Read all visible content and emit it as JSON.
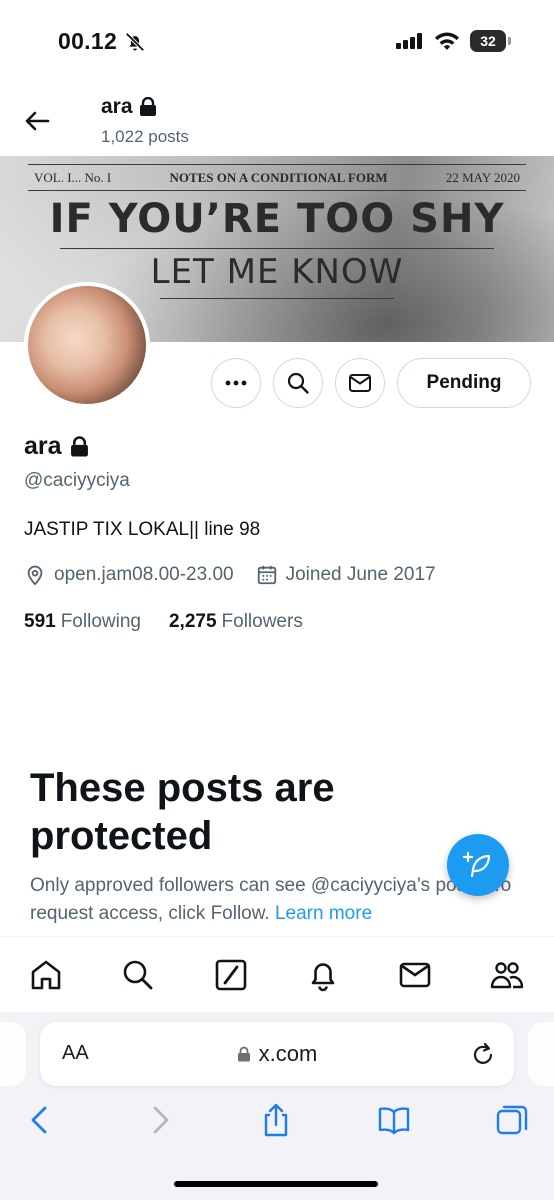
{
  "status_bar": {
    "time": "00.12",
    "battery": "32"
  },
  "header": {
    "name": "ara",
    "post_count": "1,022 posts"
  },
  "banner": {
    "vol": "VOL. I... No. I",
    "title": "NOTES ON A CONDITIONAL FORM",
    "date": "22 MAY 2020",
    "headline1": "IF YOU’RE TOO SHY",
    "headline2": "LET ME KNOW"
  },
  "actions": {
    "pending_label": "Pending"
  },
  "profile": {
    "name": "ara",
    "handle": "@caciyyciya",
    "bio": "JASTIP TIX LOKAL|| line 98",
    "location": "open.jam08.00-23.00",
    "joined": "Joined June 2017",
    "following_count": "591",
    "following_label": "Following",
    "followers_count": "2,275",
    "followers_label": "Followers"
  },
  "protected": {
    "title": "These posts are protected",
    "body": "Only approved followers can see @caciyyciya’s posts. To request access, click Follow.",
    "link": "Learn more"
  },
  "browser": {
    "aa_label": "AA",
    "host": "x.com"
  },
  "colors": {
    "accent": "#1d9bf0",
    "text_primary": "#0f1419",
    "text_secondary": "#536471",
    "border": "#cfd9de"
  },
  "icons": {
    "status": [
      "bell-slash-icon",
      "signal-icon",
      "wifi-icon",
      "battery-icon"
    ],
    "header": [
      "back-arrow-icon",
      "lock-icon"
    ],
    "actions": [
      "more-icon",
      "search-icon",
      "mail-icon"
    ],
    "meta": [
      "location-pin-icon",
      "calendar-icon"
    ],
    "tabs": [
      "home-icon",
      "search-icon",
      "grok-icon",
      "notifications-icon",
      "messages-icon",
      "communities-icon"
    ],
    "browser": [
      "reload-icon",
      "back-chevron-icon",
      "forward-chevron-icon",
      "share-icon",
      "bookmarks-icon",
      "tabs-icon"
    ]
  }
}
